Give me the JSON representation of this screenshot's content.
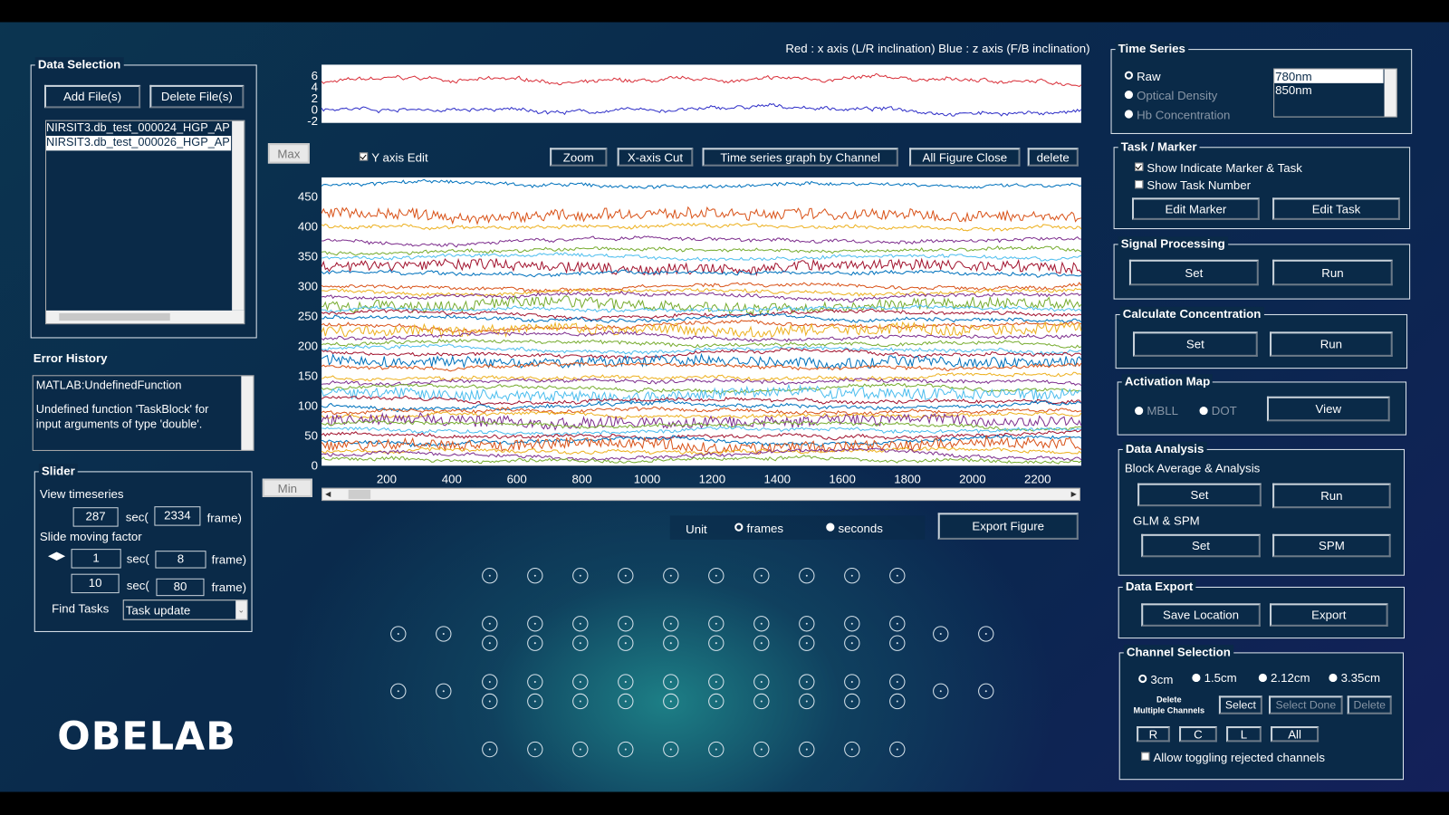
{
  "logo": "OBELAB",
  "data_selection": {
    "title": "Data Selection",
    "add_label": "Add File(s)",
    "delete_label": "Delete File(s)",
    "files": [
      "NIRSIT3.db_test_000024_HGP_AP",
      "NIRSIT3.db_test_000026_HGP_AP"
    ]
  },
  "error_history": {
    "title": "Error History",
    "line1": "MATLAB:UndefinedFunction",
    "line2": "Undefined function 'TaskBlock' for",
    "line3": "input arguments of type 'double'."
  },
  "slider": {
    "title": "Slider",
    "view_label": "View timeseries",
    "view_sec": "287",
    "view_frame": "2334",
    "moving_label": "Slide moving factor",
    "move1_sec": "1",
    "move1_frame": "8",
    "move2_sec": "10",
    "move2_frame": "80",
    "sec_label": "sec(",
    "frame_label": "frame)",
    "find_tasks_label": "Find Tasks",
    "find_tasks_value": "Task update"
  },
  "plot": {
    "legend_note": "Red : x axis (L/R inclination) Blue : z axis (F/B inclination)",
    "max_label": "Max",
    "min_label": "Min",
    "y_axis_edit": "Y axis Edit",
    "y_axis_edit_checked": true,
    "zoom": "Zoom",
    "xcut": "X-axis Cut",
    "by_channel": "Time series graph by Channel",
    "close_all": "All Figure Close",
    "delete": "delete",
    "unit_label": "Unit",
    "unit_frames": "frames",
    "unit_seconds": "seconds",
    "unit_selected": "frames",
    "export": "Export Figure",
    "slider_position": 0.02
  },
  "chart_data": [
    {
      "type": "line",
      "title": "",
      "xlim": [
        0,
        2334
      ],
      "ylim": [
        -2.3,
        8
      ],
      "yticks": [
        6,
        4,
        2,
        0,
        -2
      ],
      "series": [
        {
          "color": "#d9303a",
          "level": 5
        },
        {
          "color": "#3030c8",
          "level": 0
        }
      ]
    },
    {
      "type": "line",
      "title": "",
      "xlim": [
        0,
        2334
      ],
      "ylim": [
        0,
        483
      ],
      "xticks": [
        200,
        400,
        600,
        800,
        1000,
        1200,
        1400,
        1600,
        1800,
        2000,
        2200
      ],
      "yticks": [
        450,
        400,
        350,
        300,
        250,
        200,
        150,
        100,
        50,
        0
      ],
      "channel_levels": [
        470,
        420,
        400,
        378,
        360,
        350,
        335,
        322,
        300,
        292,
        285,
        270,
        262,
        255,
        245,
        235,
        228,
        215,
        205,
        195,
        188,
        175,
        168,
        150,
        140,
        130,
        120,
        110,
        100,
        92,
        85,
        75,
        68,
        60,
        50,
        42,
        35,
        25,
        18,
        10
      ],
      "colors": [
        "#0072bd",
        "#d95319",
        "#edb120",
        "#7e2f8e",
        "#77ac30",
        "#4dbeee",
        "#a2142f"
      ]
    }
  ],
  "time_series": {
    "title": "Time Series",
    "options": [
      "Raw",
      "Optical Density",
      "Hb Concentration"
    ],
    "selected": "Raw",
    "wavelengths": [
      "780nm",
      "850nm"
    ],
    "selected_wavelength": "780nm"
  },
  "task_marker": {
    "title": "Task / Marker",
    "show_marker": "Show Indicate Marker & Task",
    "show_marker_checked": true,
    "show_number": "Show Task Number",
    "show_number_checked": false,
    "edit_marker": "Edit Marker",
    "edit_task": "Edit Task"
  },
  "signal_processing": {
    "title": "Signal Processing",
    "set": "Set",
    "run": "Run"
  },
  "calc_conc": {
    "title": "Calculate Concentration",
    "set": "Set",
    "run": "Run"
  },
  "activation_map": {
    "title": "Activation Map",
    "mbll": "MBLL",
    "dot": "DOT",
    "view": "View"
  },
  "data_analysis": {
    "title": "Data Analysis",
    "block_label": "Block Average & Analysis",
    "set": "Set",
    "run": "Run",
    "glm_label": "GLM & SPM",
    "glm_set": "Set",
    "spm": "SPM"
  },
  "data_export": {
    "title": "Data Export",
    "save_location": "Save Location",
    "export": "Export"
  },
  "channel_selection": {
    "title": "Channel Selection",
    "distances": [
      "3cm",
      "1.5cm",
      "2.12cm",
      "3.35cm"
    ],
    "selected": "3cm",
    "delete_multi_1": "Delete",
    "delete_multi_2": "Multiple Channels",
    "select": "Select",
    "select_done": "Select Done",
    "delete": "Delete",
    "regions": [
      "R",
      "C",
      "L",
      "All"
    ],
    "allow_toggle": "Allow toggling rejected channels",
    "allow_toggle_checked": false
  }
}
